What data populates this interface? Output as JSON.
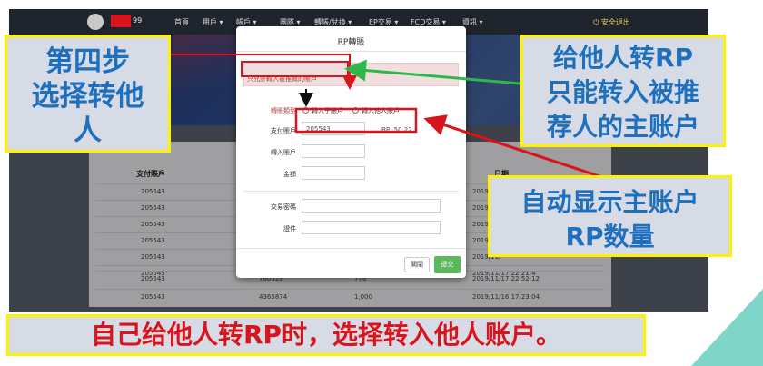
{
  "nav": {
    "brand_suffix": "99",
    "items": [
      "首頁",
      "用戶 ▾",
      "帳戶 ▾",
      "團隊 ▾",
      "轉帳/兌換 ▾",
      "EP交易 ▾",
      "FCD交易 ▾",
      "資訊 ▾"
    ],
    "logout": "⏻ 安全退出"
  },
  "table": {
    "headers": [
      "支付賬戶",
      "日期"
    ],
    "rows": [
      [
        "205543",
        "",
        "",
        "2019/11/"
      ],
      [
        "205543",
        "",
        "",
        "2019/11/"
      ],
      [
        "205543",
        "",
        "",
        "2019/11/"
      ],
      [
        "205543",
        "",
        "",
        "2019/11/"
      ],
      [
        "205543",
        "",
        "",
        "2019/11/"
      ],
      [
        "205543",
        "",
        "",
        "2019/11/17 22:21:4"
      ],
      [
        "205543",
        "760028",
        "776",
        "2019/11/17 22:52:12"
      ],
      [
        "205543",
        "4365874",
        "1,000",
        "2019/11/16 17:23:04"
      ]
    ]
  },
  "modal": {
    "title": "RP轉賬",
    "notice": "只允許轉入被推薦的賬戶",
    "type_label": "轉賬類型",
    "option_child": "轉入子賬戶",
    "option_other": "轉入他人賬戶",
    "pay_label": "支付賬戶",
    "pay_value": "205543",
    "rp_text": "RP: 50.22",
    "to_label": "轉入賬戶",
    "amount_label": "金額",
    "password_label": "交易密碼",
    "cert_label": "證件",
    "close_label": "關閉",
    "submit_label": "提交"
  },
  "annotations": {
    "left": [
      "第四步",
      "选择转他",
      "人"
    ],
    "right": [
      "给他人转RP",
      "只能转入被推",
      "荐人的主账户"
    ],
    "mid": [
      "自动显示主账户",
      "RP数量"
    ],
    "bottom": "自己给他人转RP时，选择转入他人账户。"
  },
  "colors": {
    "callout_border": "#fff200",
    "callout_text": "#1f6fbf",
    "red": "#d8141c",
    "green_arrow": "#2db84a",
    "submit_green": "#5cb85c"
  }
}
